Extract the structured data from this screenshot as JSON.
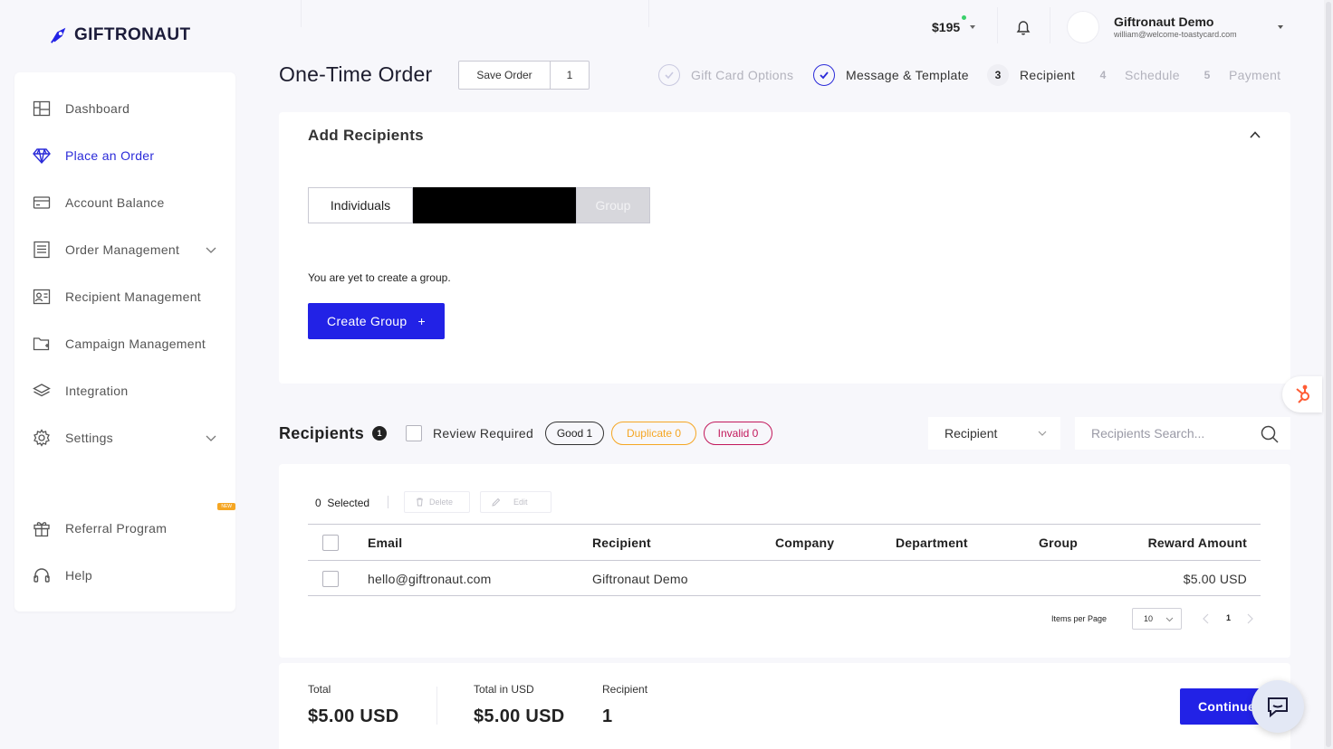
{
  "brand": {
    "name": "GIFTRONAUT",
    "accent": "#2222e6"
  },
  "sidebar": {
    "items": [
      {
        "label": "Dashboard",
        "icon": "dashboard-icon",
        "active": false
      },
      {
        "label": "Place an Order",
        "icon": "diamond-icon",
        "active": true
      },
      {
        "label": "Account Balance",
        "icon": "credit-card-icon",
        "active": false
      },
      {
        "label": "Order Management",
        "icon": "list-icon",
        "active": false,
        "expandable": true
      },
      {
        "label": "Recipient Management",
        "icon": "contact-card-icon",
        "active": false
      },
      {
        "label": "Campaign Management",
        "icon": "folder-plus-icon",
        "active": false
      },
      {
        "label": "Integration",
        "icon": "layers-icon",
        "active": false
      },
      {
        "label": "Settings",
        "icon": "gear-icon",
        "active": false,
        "expandable": true
      },
      {
        "label": "Referral Program",
        "icon": "gift-icon",
        "active": false,
        "badge": "NEW"
      },
      {
        "label": "Help",
        "icon": "headset-icon",
        "active": false
      }
    ]
  },
  "header": {
    "balance": "$195",
    "user_name": "Giftronaut Demo",
    "user_email": "william@welcome-toastycard.com"
  },
  "order": {
    "title": "One-Time Order",
    "save_label": "Save Order",
    "save_count": "1"
  },
  "stepper": [
    {
      "number": "",
      "label": "Gift Card Options",
      "state": "done-light"
    },
    {
      "number": "",
      "label": "Message & Template",
      "state": "done"
    },
    {
      "number": "3",
      "label": "Recipient",
      "state": "current"
    },
    {
      "number": "4",
      "label": "Schedule",
      "state": "future"
    },
    {
      "number": "5",
      "label": "Payment",
      "state": "future"
    }
  ],
  "add_recipients": {
    "title": "Add Recipients",
    "tabs": {
      "individuals": "Individuals",
      "group": "Group"
    },
    "empty_message": "You are yet to create a group.",
    "create_group_label": "Create Group",
    "create_group_icon": "+"
  },
  "recipients": {
    "title": "Recipients",
    "count": "1",
    "review_required_label": "Review Required",
    "good_label": "Good 1",
    "duplicate_label": "Duplicate 0",
    "invalid_label": "Invalid 0",
    "filter_value": "Recipient",
    "search_placeholder": "Recipients Search...",
    "selected_label": "0  Selected",
    "delete_label": "Delete",
    "edit_label": "Edit",
    "columns": [
      "Email",
      "Recipient",
      "Company",
      "Department",
      "Group",
      "Reward Amount"
    ],
    "rows": [
      {
        "email": "hello@giftronaut.com",
        "recipient": "Giftronaut Demo",
        "company": "",
        "department": "",
        "group": "",
        "reward": "$5.00 USD"
      }
    ],
    "items_per_page_label": "Items per Page",
    "items_per_page_value": "10",
    "current_page": "1"
  },
  "summary": {
    "total_label": "Total",
    "total_value": "$5.00 USD",
    "total_usd_label": "Total in USD",
    "total_usd_value": "$5.00 USD",
    "recipient_label": "Recipient",
    "recipient_value": "1",
    "continue_label": "Continue"
  }
}
